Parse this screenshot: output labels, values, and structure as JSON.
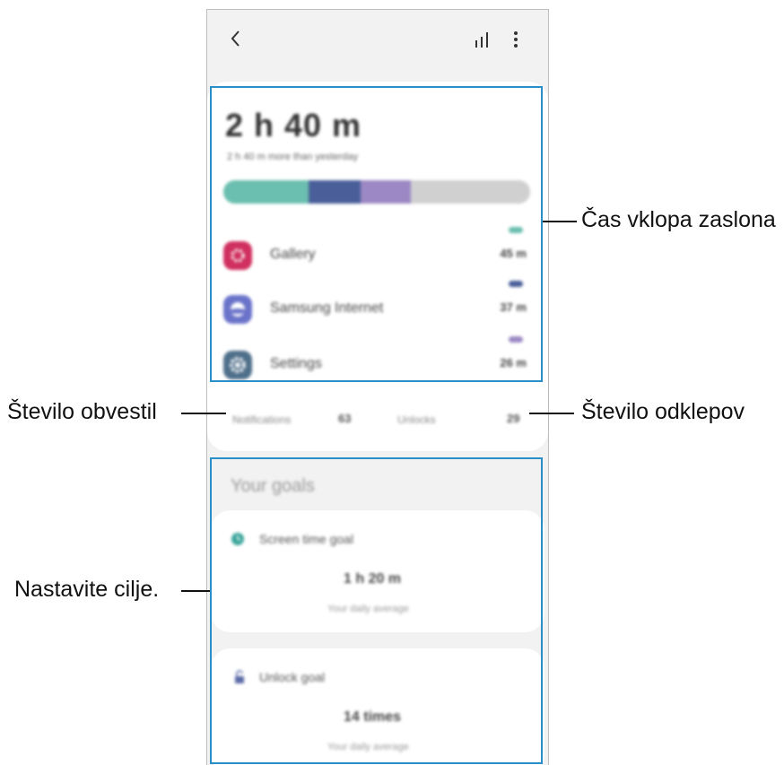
{
  "screen": {
    "total_time": "2 h 40 m",
    "compare_text": "2 h 40 m more than yesterday",
    "usage_colors": [
      "#6bbfb0",
      "#4a5f9a",
      "#9b88c4",
      "#d0d0d0"
    ],
    "apps": [
      {
        "name": "Gallery",
        "time": "45 m",
        "icon": "gallery-flower-icon",
        "color": "#d0305f",
        "dot": "#6bbfb0"
      },
      {
        "name": "Samsung Internet",
        "time": "37 m",
        "icon": "samsung-internet-icon",
        "color": "#6a73c9",
        "dot": "#4a5f9a"
      },
      {
        "name": "Settings",
        "time": "26 m",
        "icon": "settings-gear-icon",
        "color": "#4f6f8a",
        "dot": "#9b88c4"
      }
    ],
    "notifications_label": "Notifications",
    "notifications_count": "63",
    "unlocks_label": "Unlocks",
    "unlocks_count": "29",
    "goals_title": "Your goals",
    "screen_goal": {
      "name": "Screen time goal",
      "value": "1 h 20 m",
      "sub": "Your daily average"
    },
    "unlock_goal": {
      "name": "Unlock goal",
      "value": "14 times",
      "sub": "Your daily average"
    }
  },
  "callouts": {
    "screen_time": "Čas vklopa zaslona",
    "notifications": "Število obvestil",
    "unlocks": "Število odklepov",
    "goals": "Nastavite cilje."
  },
  "highlight_color": "#2a8ec9"
}
